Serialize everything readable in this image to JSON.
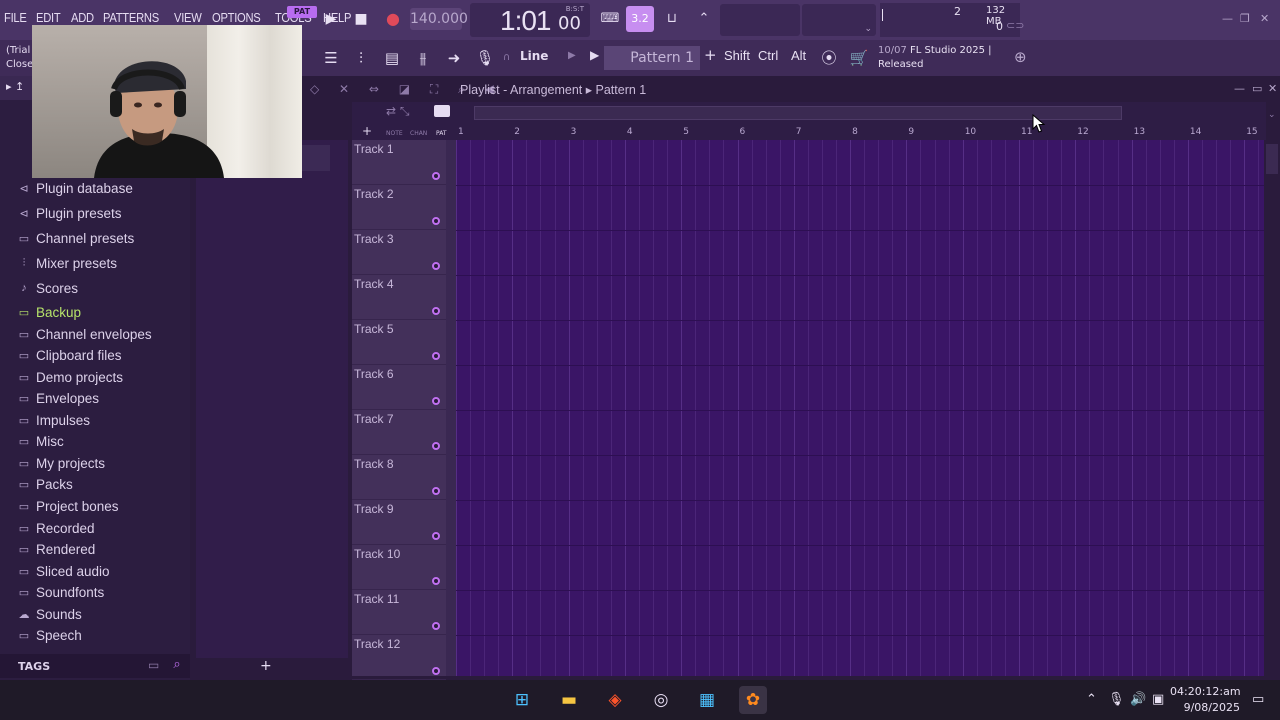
{
  "menu": [
    "FILE",
    "EDIT",
    "ADD",
    "PATTERNS",
    "VIEW",
    "OPTIONS",
    "TOOLS",
    "HELP"
  ],
  "transport": {
    "pat_song": "PAT",
    "tempo": "140.000",
    "time": "1:01",
    "time_sub": "00",
    "time_unit": "B:S:T",
    "rate": "3.2"
  },
  "monitor": {
    "cpu": "2",
    "memory": "132 MB",
    "polyphony": "0"
  },
  "toolbar2": {
    "snap": "Line",
    "pattern": "Pattern 1",
    "mods": [
      "Shift",
      "Ctrl",
      "Alt"
    ]
  },
  "hint": {
    "date": "10/07",
    "line1": "FL Studio 2025 |",
    "line2": "Released"
  },
  "left_overlay": {
    "line1": "(Trial",
    "line2": "Close"
  },
  "browser": {
    "items": [
      {
        "label": "Plugin database",
        "icon": "plug-icon",
        "green": false
      },
      {
        "label": "Plugin presets",
        "icon": "plug-icon",
        "green": false
      },
      {
        "label": "Channel presets",
        "icon": "folder-icon",
        "green": false
      },
      {
        "label": "Mixer presets",
        "icon": "mixer-icon",
        "green": false
      },
      {
        "label": "Scores",
        "icon": "note-icon",
        "green": false
      },
      {
        "label": "Backup",
        "icon": "folder-icon",
        "green": true
      },
      {
        "label": "Channel envelopes",
        "icon": "folder-icon",
        "green": false
      },
      {
        "label": "Clipboard files",
        "icon": "folder-icon",
        "green": false
      },
      {
        "label": "Demo projects",
        "icon": "folder-icon",
        "green": false
      },
      {
        "label": "Envelopes",
        "icon": "folder-icon",
        "green": false
      },
      {
        "label": "Impulses",
        "icon": "folder-icon",
        "green": false
      },
      {
        "label": "Misc",
        "icon": "folder-icon",
        "green": false
      },
      {
        "label": "My projects",
        "icon": "folder-icon",
        "green": false
      },
      {
        "label": "Packs",
        "icon": "folder-icon",
        "green": false
      },
      {
        "label": "Project bones",
        "icon": "folder-icon",
        "green": false
      },
      {
        "label": "Recorded",
        "icon": "folder-icon",
        "green": false
      },
      {
        "label": "Rendered",
        "icon": "folder-icon",
        "green": false
      },
      {
        "label": "Sliced audio",
        "icon": "folder-icon",
        "green": false
      },
      {
        "label": "Soundfonts",
        "icon": "folder-icon",
        "green": false
      },
      {
        "label": "Sounds",
        "icon": "cloud-icon",
        "green": false
      },
      {
        "label": "Speech",
        "icon": "folder-icon",
        "green": false
      }
    ],
    "tags_label": "TAGS"
  },
  "playlist": {
    "title": "Playlist - Arrangement",
    "pattern": "Pattern 1",
    "tools": [
      "NOTE",
      "CHAN",
      "PAT"
    ],
    "ruler": [
      "1",
      "2",
      "3",
      "4",
      "5",
      "6",
      "7",
      "8",
      "9",
      "10",
      "11",
      "12",
      "13",
      "14",
      "15"
    ],
    "tracks": [
      "Track 1",
      "Track 2",
      "Track 3",
      "Track 4",
      "Track 5",
      "Track 6",
      "Track 7",
      "Track 8",
      "Track 9",
      "Track 10",
      "Track 11",
      "Track 12"
    ]
  },
  "taskbar": {
    "time": "04:20:12:am",
    "date": "9/08/2025"
  },
  "colors": {
    "accent": "#c070f0",
    "grid_bg": "#3a1566",
    "green_folder": "#b6e36a"
  }
}
